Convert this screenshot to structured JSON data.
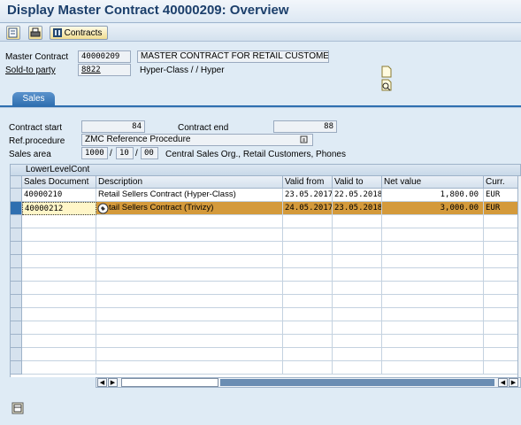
{
  "window": {
    "title": "Display Master Contract 40000209: Overview"
  },
  "toolbar": {
    "contracts_label": "Contracts"
  },
  "header": {
    "master_contract_label": "Master Contract",
    "master_contract_value": "40000209",
    "master_contract_desc": "MASTER CONTRACT FOR RETAIL CUSTOMERS",
    "sold_to_label": "Sold-to party",
    "sold_to_value": "8822",
    "sold_to_name": "Hyper-Class / / Hyper"
  },
  "tabs": [
    {
      "label": "Sales"
    }
  ],
  "sales": {
    "contract_start_label": "Contract start",
    "contract_start_value": "84",
    "contract_end_label": "Contract end",
    "contract_end_value": "88",
    "ref_procedure_label": "Ref.procedure",
    "ref_procedure_value": "ZMC Reference Procedure",
    "sales_area_label": "Sales area",
    "sales_org": "1000",
    "dist_channel": "10",
    "division": "00",
    "sales_area_sep": "/",
    "sales_area_desc": "Central Sales Org., Retail Customers, Phones"
  },
  "table": {
    "title": "LowerLevelCont",
    "columns": [
      "Sales Document",
      "Description",
      "Valid from",
      "Valid to",
      "Net value",
      "Curr."
    ],
    "rows": [
      {
        "doc": "40000210",
        "desc": "Retail Sellers Contract (Hyper-Class)",
        "from": "23.05.2017",
        "to": "22.05.2018",
        "net": "1,800.00",
        "curr": "EUR"
      },
      {
        "doc": "40000212",
        "desc": "tail Sellers Contract (Trivizy)",
        "from": "24.05.2017",
        "to": "23.05.2018",
        "net": "3,000.00",
        "curr": "EUR"
      }
    ]
  },
  "colors": {
    "title": "#1c3f6b",
    "tab_active": "#2f6fb0",
    "row_highlight": "#d49a3b"
  }
}
